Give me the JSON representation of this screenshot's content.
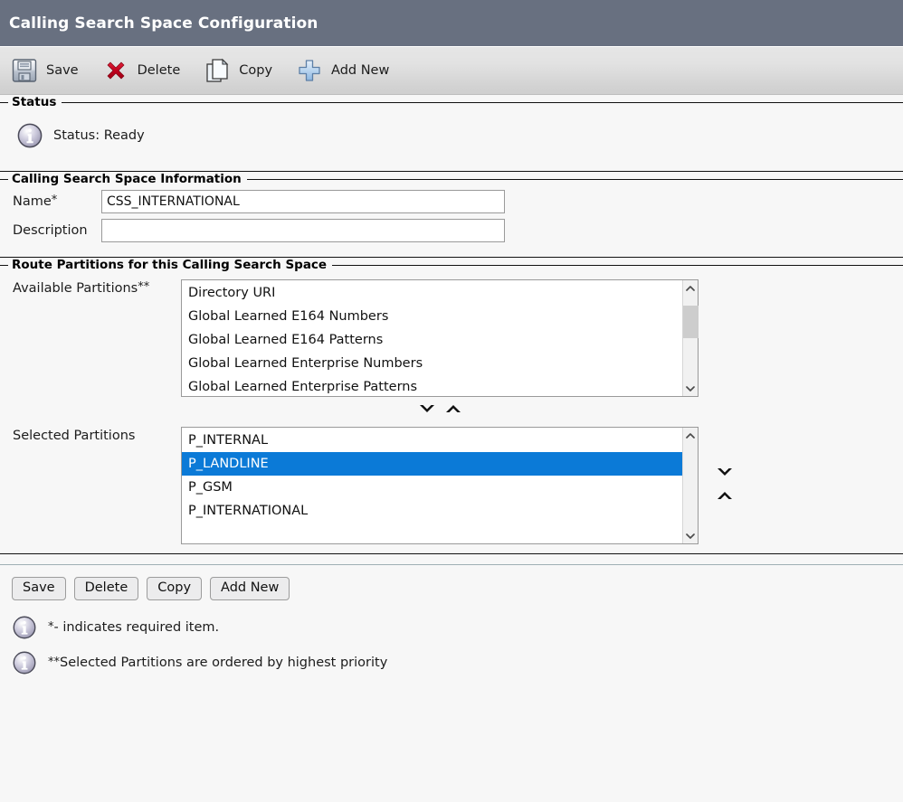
{
  "header": {
    "title": "Calling Search Space Configuration"
  },
  "toolbar": {
    "items": [
      {
        "label": "Save",
        "icon": "save-icon"
      },
      {
        "label": "Delete",
        "icon": "delete-icon"
      },
      {
        "label": "Copy",
        "icon": "copy-icon"
      },
      {
        "label": "Add New",
        "icon": "add-new-icon"
      }
    ]
  },
  "status": {
    "legend": "Status",
    "icon": "info-icon",
    "text": "Status: Ready"
  },
  "css_info": {
    "legend": "Calling Search Space Information",
    "name_label": "Name",
    "name_required_marker": "*",
    "name_value": "CSS_INTERNATIONAL",
    "name_placeholder": "",
    "description_label": "Description",
    "description_value": "",
    "description_placeholder": ""
  },
  "partitions": {
    "legend": "Route Partitions for this Calling Search Space",
    "available_label": "Available Partitions",
    "available_marker": "**",
    "available_items": [
      "Directory URI",
      "Global Learned E164 Numbers",
      "Global Learned E164 Patterns",
      "Global Learned Enterprise Numbers",
      "Global Learned Enterprise Patterns"
    ],
    "selected_label": "Selected Partitions",
    "selected_items": [
      "P_INTERNAL",
      "P_LANDLINE",
      "P_GSM",
      "P_INTERNATIONAL"
    ],
    "selected_highlight_index": 1,
    "move_down_icon": "chevron-down-icon",
    "move_up_icon": "chevron-up-icon",
    "scroll_up_icon": "scroll-up-icon",
    "scroll_down_icon": "scroll-down-icon"
  },
  "bottom_buttons": [
    {
      "label": "Save"
    },
    {
      "label": "Delete"
    },
    {
      "label": "Copy"
    },
    {
      "label": "Add New"
    }
  ],
  "notes": [
    {
      "marker": "*",
      "text": "- indicates required item."
    },
    {
      "marker": "**",
      "text": "Selected Partitions are ordered by highest priority"
    }
  ],
  "colors": {
    "header_bg": "#687080",
    "highlight": "#0b7ad7",
    "toolbar_bg": "#e0e0e0",
    "page_bg": "#f7f7f7"
  }
}
